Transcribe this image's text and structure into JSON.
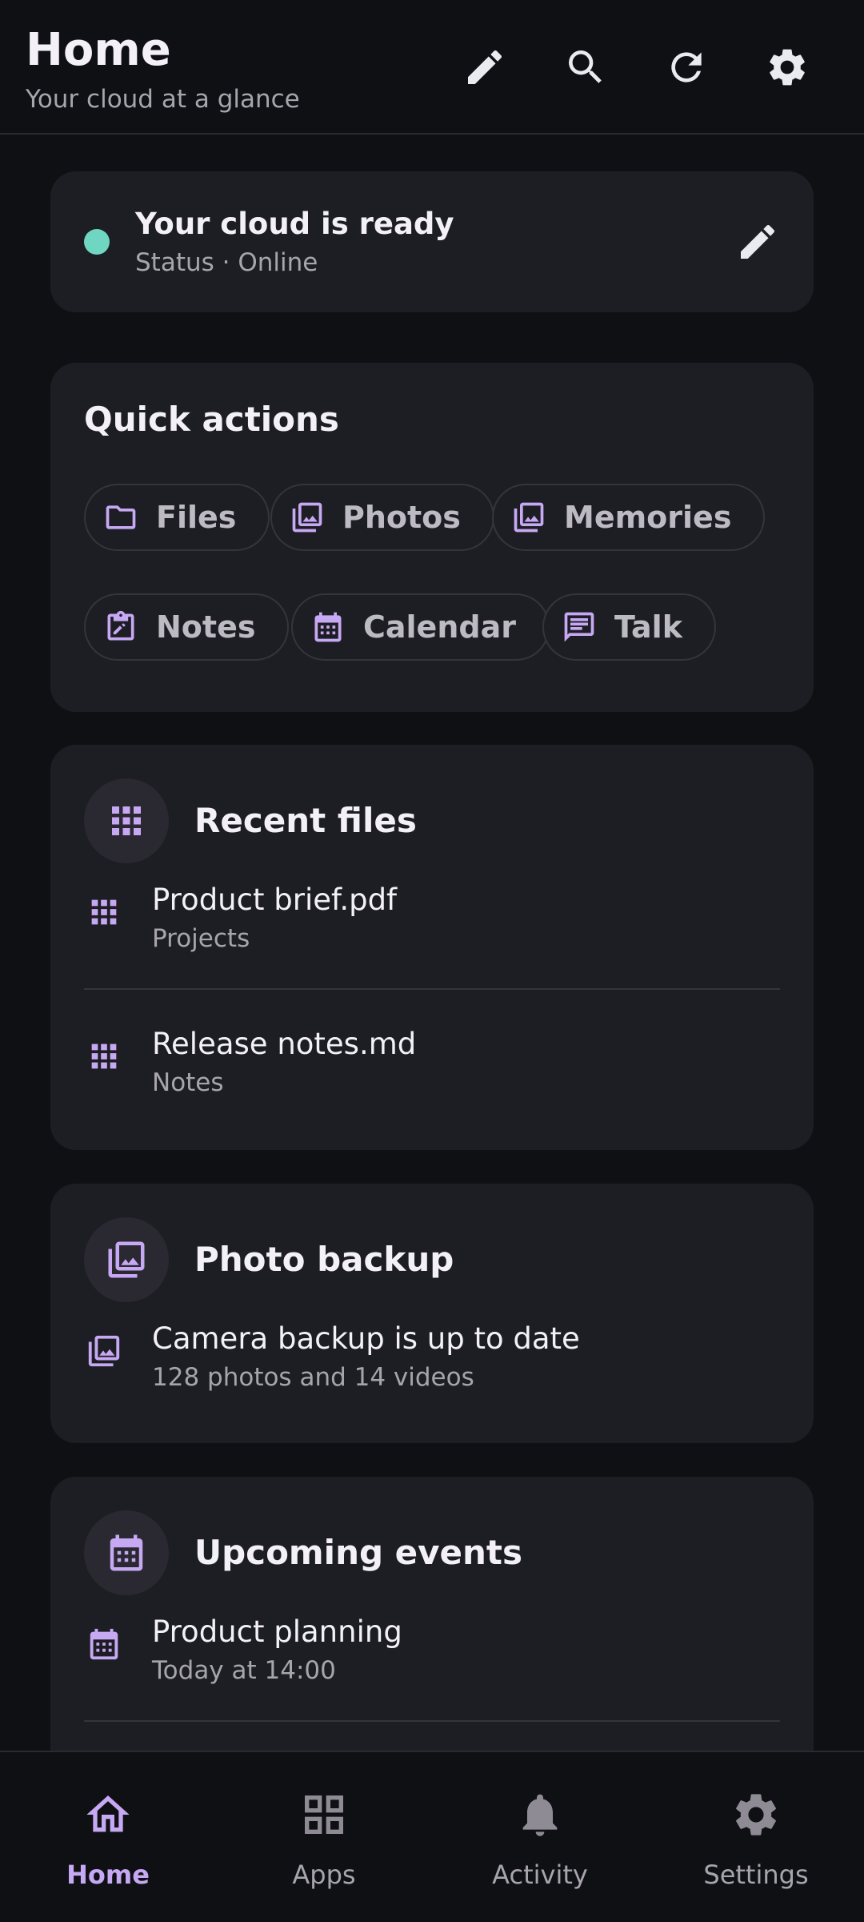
{
  "header": {
    "title": "Home",
    "subtitle": "Your cloud at a glance",
    "actions": [
      "pencil-icon",
      "search-icon",
      "refresh-icon",
      "gear-icon"
    ]
  },
  "status": {
    "title": "Your cloud is ready",
    "subtitle": "Status · Online",
    "dot_color": "#6fd7c1"
  },
  "quick_actions": {
    "title": "Quick actions",
    "chips": [
      {
        "label": "Files",
        "icon": "folder-icon"
      },
      {
        "label": "Photos",
        "icon": "photo-library-icon"
      },
      {
        "label": "Memories",
        "icon": "photo-library-icon"
      },
      {
        "label": "Notes",
        "icon": "note-edit-icon"
      },
      {
        "label": "Calendar",
        "icon": "calendar-icon"
      },
      {
        "label": "Talk",
        "icon": "chat-icon"
      }
    ]
  },
  "recent_files": {
    "title": "Recent files",
    "items": [
      {
        "name": "Product brief.pdf",
        "folder": "Projects"
      },
      {
        "name": "Release notes.md",
        "folder": "Notes"
      }
    ]
  },
  "photo_backup": {
    "title": "Photo backup",
    "item": {
      "title": "Camera backup is up to date",
      "subtitle": "128 photos and 14 videos"
    }
  },
  "events": {
    "title": "Upcoming events",
    "items": [
      {
        "title": "Product planning",
        "subtitle": "Today at 14:00"
      }
    ]
  },
  "nav": {
    "items": [
      {
        "label": "Home",
        "icon": "home-icon",
        "active": true
      },
      {
        "label": "Apps",
        "icon": "apps-grid-icon",
        "active": false
      },
      {
        "label": "Activity",
        "icon": "bell-icon",
        "active": false
      },
      {
        "label": "Settings",
        "icon": "gear-icon",
        "active": false
      }
    ]
  },
  "colors": {
    "background": "#0f1013",
    "card": "#1d1e23",
    "accent": "#c6a8f3",
    "status_online": "#6fd7c1"
  }
}
